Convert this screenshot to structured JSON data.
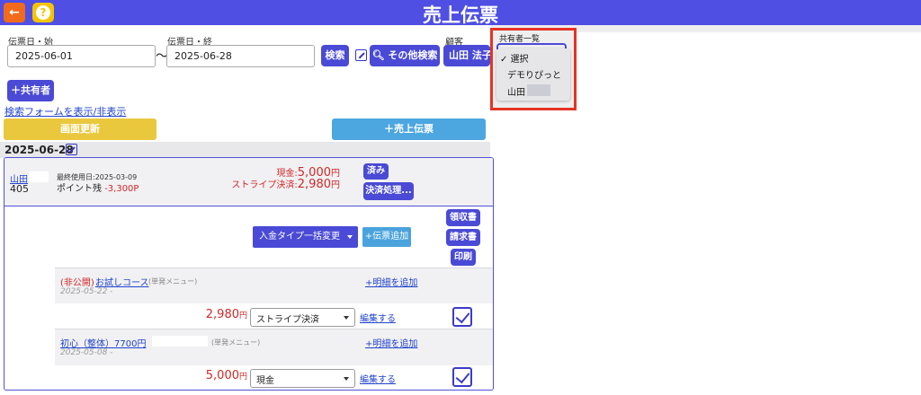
{
  "header": {
    "title": "売上伝票",
    "back_icon": "arrow-left",
    "help_icon": "question-mark"
  },
  "search": {
    "date_from_label": "伝票日・始",
    "date_from": "2025-06-01",
    "date_to_label": "伝票日・終",
    "date_to": "2025-06-28",
    "range_sep": "〜",
    "search_btn": "検索",
    "other_search_btn": "その他検索",
    "customer_label": "顧客",
    "customer_value": "山田 法子",
    "add_sharer_btn": "＋共有者",
    "toggle_form_link": "検索フォームを表示/非表示"
  },
  "sharer_dropdown": {
    "label": "共有者一覧",
    "options": [
      "✓ 選択",
      "デモりぴっと",
      "山田"
    ]
  },
  "actions": {
    "refresh_btn": "画面更新",
    "add_slip_btn": "＋売上伝票"
  },
  "slip_group": {
    "date": "2025-06-28",
    "customer": {
      "name": "山田",
      "id": "405",
      "last_used": "最終使用日:2025-03-09",
      "points_label": "ポイント残",
      "points_value": "-3,300P"
    },
    "payments": [
      {
        "label": "現金:",
        "amount": "5,000",
        "unit": "円"
      },
      {
        "label": "ストライプ決済:",
        "amount": "2,980",
        "unit": "円"
      }
    ],
    "done_btn": "済み",
    "process_btn": "決済処理...",
    "bulk_change": "入金タイプ一括変更",
    "add_slip_small": "+伝票追加",
    "receipt_btn": "領収書",
    "invoice_btn": "請求書",
    "print_btn": "印刷",
    "items": [
      {
        "private_tag": "(非公開)",
        "name": "お試しコース",
        "kind": "(単発メニュー)",
        "date": "2025-05-22 -",
        "add_detail": "+明細を追加",
        "price": "2,980",
        "unit": "円",
        "pay_type": "ストライプ決済",
        "edit": "編集する"
      },
      {
        "private_tag": "",
        "name": "初心（整体）7700円",
        "kind": "(単発メニュー)",
        "date": "2025-05-08 -",
        "add_detail": "+明細を追加",
        "price": "5,000",
        "unit": "円",
        "pay_type": "現金",
        "edit": "編集する"
      }
    ]
  },
  "colors": {
    "brand": "#4f4fe3",
    "accent_orange": "#f26a1b",
    "help_yellow": "#f5c400",
    "refresh": "#e9c83e",
    "add_slip": "#4ca6df",
    "price_red": "#d02828",
    "highlight_box": "#e53425"
  }
}
